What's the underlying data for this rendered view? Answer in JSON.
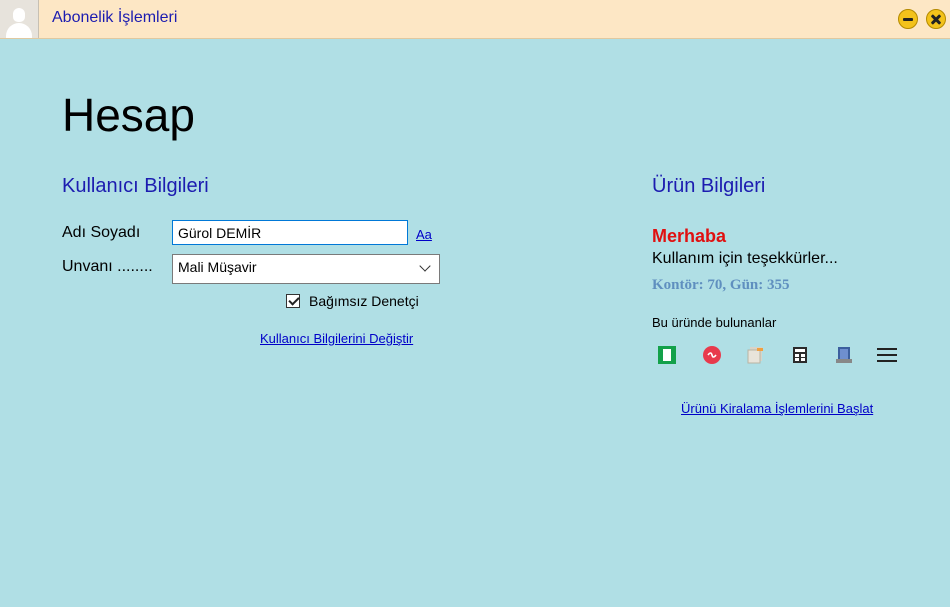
{
  "window": {
    "title": "Abonelik İşlemleri"
  },
  "page": {
    "heading": "Hesap"
  },
  "user_info": {
    "section_title": "Kullanıcı Bilgileri",
    "name_label": "Adı Soyadı",
    "name_value": "Gürol DEMİR",
    "font_link": "Aa",
    "title_label": "Unvanı ........",
    "title_value": "Mali Müşavir",
    "checkbox_label": "Bağımsız Denetçi",
    "checkbox_checked": true,
    "change_link": "Kullanıcı Bilgilerini Değiştir"
  },
  "product_info": {
    "section_title": "Ürün Bilgileri",
    "greeting": "Merhaba",
    "thanks": "Kullanım için teşekkürler...",
    "credit": "Kontör: 70, Gün: 355",
    "included_label": "Bu üründe bulunanlar",
    "modules": [
      "green-document-icon",
      "red-circle-icon",
      "document-stack-icon",
      "calculator-icon",
      "book-icon",
      "menu-icon"
    ],
    "rent_link": "Ürünü Kiralama İşlemlerini Başlat"
  }
}
